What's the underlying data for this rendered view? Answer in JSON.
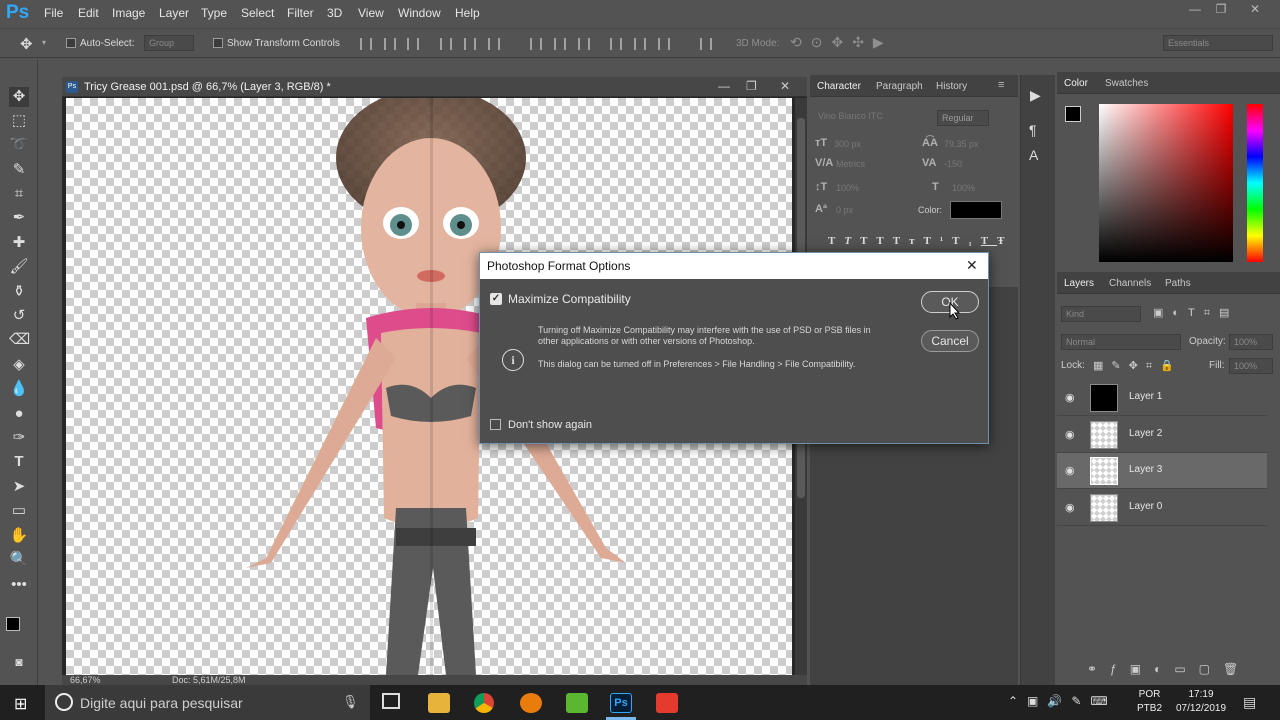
{
  "app": {
    "logo": "Ps",
    "menu": [
      "File",
      "Edit",
      "Image",
      "Layer",
      "Type",
      "Select",
      "Filter",
      "3D",
      "View",
      "Window",
      "Help"
    ],
    "window_controls": [
      "—",
      "❐",
      "✕"
    ]
  },
  "options_bar": {
    "auto_select_label": "Auto-Select:",
    "auto_select_value": "Group",
    "show_transform_label": "Show Transform Controls",
    "mode_3d_label": "3D Mode:",
    "workspace": "Essentials"
  },
  "document": {
    "title": "Tricy Grease 001.psd @ 66,7% (Layer 3, RGB/8) *",
    "zoom": "66,67%",
    "doc_size": "Doc: 5,61M/25,8M"
  },
  "character_panel": {
    "tabs": [
      "Character",
      "Paragraph",
      "History"
    ],
    "font_family": "Vino Bianco ITC",
    "font_style": "Regular",
    "size": "300 px",
    "leading": "79,35 px",
    "kerning": "Metrics",
    "tracking": "-150",
    "vertical_scale": "100%",
    "horizontal_scale": "100%",
    "baseline": "0 px",
    "color_label": "Color:",
    "style_buttons": [
      "T",
      "T",
      "TT",
      "Tт",
      "T¹",
      "T₁",
      "T",
      "Ŧ"
    ]
  },
  "color_panel": {
    "tabs": [
      "Color",
      "Swatches"
    ],
    "foreground": "#000000",
    "background": "#ffffff",
    "hue_color": "#ff0000"
  },
  "layers_panel": {
    "tabs": [
      "Layers",
      "Channels",
      "Paths"
    ],
    "filter_label": "Kind",
    "blend_mode": "Normal",
    "opacity_label": "Opacity:",
    "opacity_value": "100%",
    "lock_label": "Lock:",
    "fill_label": "Fill:",
    "fill_value": "100%",
    "layers": [
      {
        "name": "Layer 1",
        "thumb": "black",
        "selected": false
      },
      {
        "name": "Layer 2",
        "thumb": "figure",
        "selected": false
      },
      {
        "name": "Layer 3",
        "thumb": "figure",
        "selected": true
      },
      {
        "name": "Layer 0",
        "thumb": "figure",
        "selected": false
      }
    ]
  },
  "dialog": {
    "title": "Photoshop Format Options",
    "checkbox_label": "Maximize Compatibility",
    "checkbox_checked": true,
    "info_text_1": "Turning off Maximize Compatibility may interfere with the use of PSD or PSB files in other applications or with other versions of Photoshop.",
    "info_text_2": "This dialog can be turned off in Preferences > File Handling > File Compatibility.",
    "dont_show_label": "Don't show again",
    "ok_label": "OK",
    "cancel_label": "Cancel"
  },
  "taskbar": {
    "search_placeholder": "Digite aqui para pesquisar",
    "lang_1": "POR",
    "lang_2": "PTB2",
    "time": "17:19",
    "date": "07/12/2019"
  }
}
